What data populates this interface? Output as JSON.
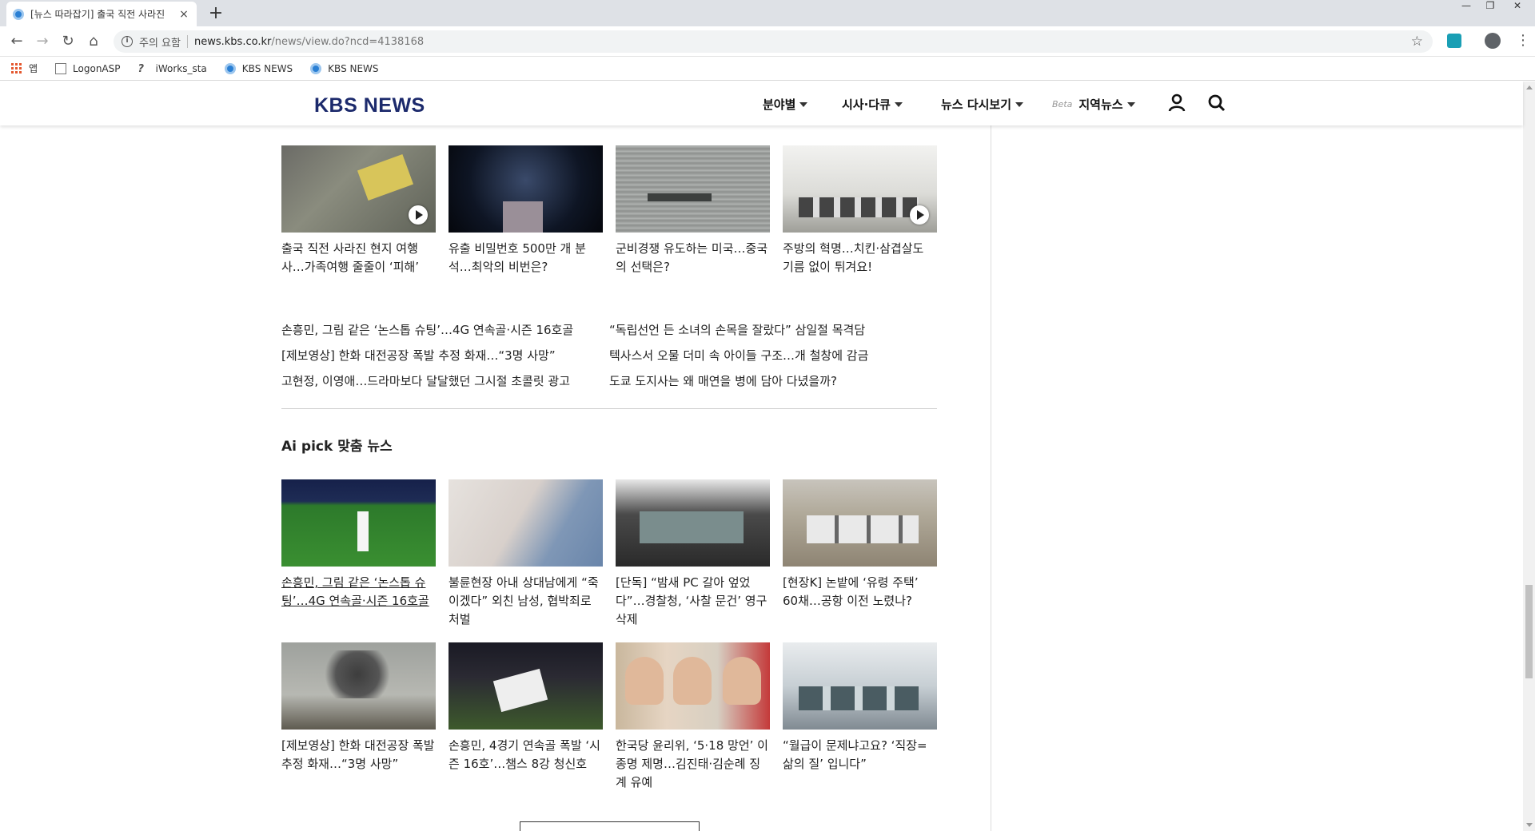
{
  "browser": {
    "tab_title": "[뉴스 따라잡기] 출국 직전 사라진",
    "tab_close": "×",
    "new_tab": "+",
    "url_warning": "주의 요함",
    "url_host": "news.kbs.co.kr",
    "url_path": "/news/view.do?ncd=4138168",
    "bookmarks": [
      {
        "label": "앱",
        "icon": "apps-icon"
      },
      {
        "label": "LogonASP",
        "icon": "page-icon"
      },
      {
        "label": "iWorks_sta",
        "icon": "iworks-icon"
      },
      {
        "label": "KBS NEWS",
        "icon": "kbs-icon"
      },
      {
        "label": "KBS NEWS",
        "icon": "kbs-icon"
      }
    ]
  },
  "site": {
    "logo": "KBS NEWS",
    "nav": [
      {
        "label": "분야별"
      },
      {
        "label": "시사·다큐"
      },
      {
        "label": "뉴스 다시보기"
      },
      {
        "beta": "Beta",
        "label": "지역뉴스"
      }
    ]
  },
  "top_cards": [
    {
      "caption": "출국 직전 사라진 현지 여행사…가족여행 줄줄이 ‘피해’",
      "video": true
    },
    {
      "caption": "유출 비밀번호 500만 개 분석…최악의 비번은?",
      "video": false
    },
    {
      "caption": "군비경쟁 유도하는 미국…중국의 선택은?",
      "video": false
    },
    {
      "caption": "주방의 혁명…치킨·삼겹살도 기름 없이 튀겨요!",
      "video": true
    }
  ],
  "text_links_left": [
    "손흥민, 그림 같은 ‘논스톱 슈팅’…4G 연속골·시즌 16호골",
    "[제보영상] 한화 대전공장 폭발 추정 화재…“3명 사망”",
    "고현정, 이영애…드라마보다 달달했던 그시절 초콜릿 광고"
  ],
  "text_links_right": [
    "“독립선언 든 소녀의 손목을 잘랐다” 삼일절 목격담",
    "텍사스서 오물 더미 속 아이들 구조…개 철창에 감금",
    "도쿄 도지사는 왜 매연을 병에 담아 다녔을까?"
  ],
  "ai_section": {
    "title": "Ai pick 맞춤 뉴스",
    "row1": [
      {
        "caption": "손흥민, 그림 같은 ‘논스톱 슈팅’…4G 연속골·시즌 16호골",
        "hovered": true
      },
      {
        "caption": "불륜현장 아내 상대남에게 “죽이겠다” 외친 남성, 협박죄로 처벌",
        "hovered": false
      },
      {
        "caption": "[단독] “밤새 PC 갈아 엎었다”…경찰청, ‘사찰 문건’ 영구 삭제",
        "hovered": false
      },
      {
        "caption": "[현장K] 논밭에 ‘유령 주택’ 60채…공항 이전 노렸나?",
        "hovered": false
      }
    ],
    "row2": [
      {
        "caption": "[제보영상] 한화 대전공장 폭발 추정 화재…“3명 사망”"
      },
      {
        "caption": "손흥민, 4경기 연속골 폭발 ‘시즌 16호’…챔스 8강 청신호"
      },
      {
        "caption": "한국당 윤리위, ‘5·18 망언’ 이종명 제명…김진태·김순례 징계 유예"
      },
      {
        "caption": "“월급이 문제냐고요? ‘직장=삶의 질’ 입니다”"
      }
    ]
  }
}
